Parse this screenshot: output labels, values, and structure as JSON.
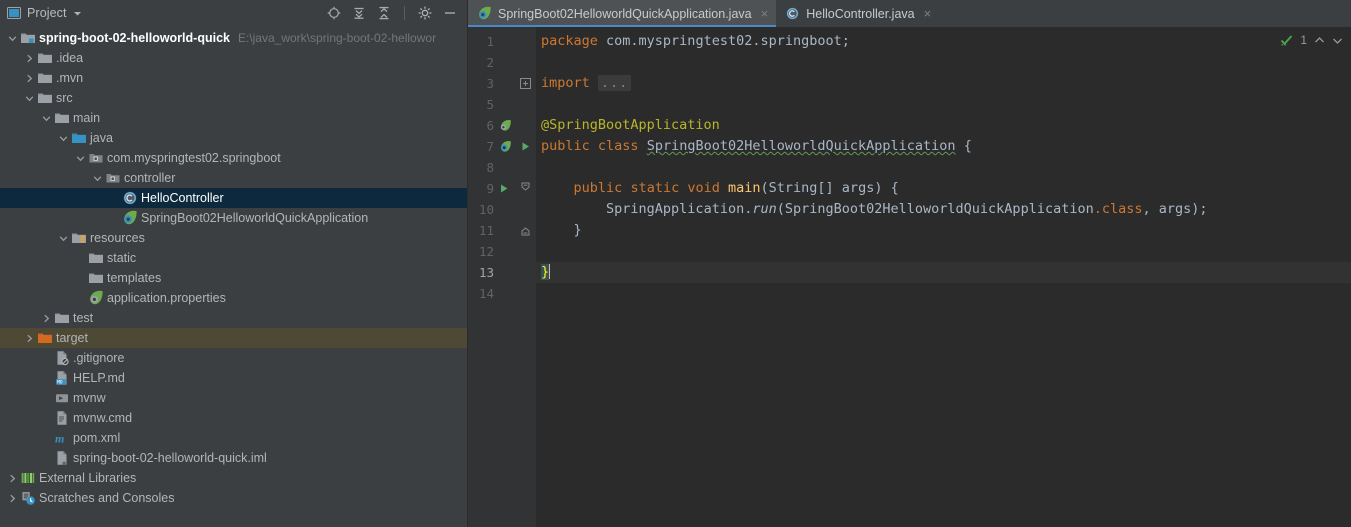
{
  "sidebar": {
    "header": {
      "title": "Project",
      "dropdown_icon": "chevron-down-icon",
      "view_icon": "project-view-icon",
      "actions": [
        {
          "name": "select-opened-file-icon",
          "label": "Select Opened File"
        },
        {
          "name": "expand-all-icon",
          "label": "Expand All"
        },
        {
          "name": "collapse-all-icon",
          "label": "Collapse All"
        },
        {
          "name": "settings-gear-icon",
          "label": "Settings"
        },
        {
          "name": "hide-panel-icon",
          "label": "Hide"
        }
      ]
    },
    "tree": [
      {
        "label": "spring-boot-02-helloworld-quick",
        "path": "E:\\java_work\\spring-boot-02-hellowor",
        "indent": 0,
        "arrow": "down",
        "icon": "module-folder-icon",
        "state": "root"
      },
      {
        "label": ".idea",
        "indent": 1,
        "arrow": "right",
        "icon": "folder-icon",
        "state": "normal"
      },
      {
        "label": ".mvn",
        "indent": 1,
        "arrow": "right",
        "icon": "folder-icon",
        "state": "normal"
      },
      {
        "label": "src",
        "indent": 1,
        "arrow": "down",
        "icon": "folder-icon",
        "state": "normal"
      },
      {
        "label": "main",
        "indent": 2,
        "arrow": "down",
        "icon": "folder-icon",
        "state": "normal"
      },
      {
        "label": "java",
        "indent": 3,
        "arrow": "down",
        "icon": "source-folder-icon",
        "state": "normal"
      },
      {
        "label": "com.myspringtest02.springboot",
        "indent": 4,
        "arrow": "down",
        "icon": "package-icon",
        "state": "normal"
      },
      {
        "label": "controller",
        "indent": 5,
        "arrow": "down",
        "icon": "package-icon",
        "state": "normal"
      },
      {
        "label": "HelloController",
        "indent": 6,
        "arrow": "none",
        "icon": "java-class-icon",
        "state": "selected"
      },
      {
        "label": "SpringBoot02HelloworldQuickApplication",
        "indent": 6,
        "arrow": "none",
        "icon": "spring-boot-class-icon",
        "state": "normal"
      },
      {
        "label": "resources",
        "indent": 3,
        "arrow": "down",
        "icon": "resources-folder-icon",
        "state": "normal"
      },
      {
        "label": "static",
        "indent": 4,
        "arrow": "none",
        "icon": "folder-icon",
        "state": "normal"
      },
      {
        "label": "templates",
        "indent": 4,
        "arrow": "none",
        "icon": "folder-icon",
        "state": "normal"
      },
      {
        "label": "application.properties",
        "indent": 4,
        "arrow": "none",
        "icon": "spring-properties-icon",
        "state": "normal"
      },
      {
        "label": "test",
        "indent": 2,
        "arrow": "right",
        "icon": "folder-icon",
        "state": "normal"
      },
      {
        "label": "target",
        "indent": 1,
        "arrow": "right",
        "icon": "excluded-folder-icon",
        "state": "target"
      },
      {
        "label": ".gitignore",
        "indent": 2,
        "arrow": "none",
        "icon": "gitignore-file-icon",
        "state": "normal"
      },
      {
        "label": "HELP.md",
        "indent": 2,
        "arrow": "none",
        "icon": "markdown-file-icon",
        "state": "normal"
      },
      {
        "label": "mvnw",
        "indent": 2,
        "arrow": "none",
        "icon": "shell-script-icon",
        "state": "normal"
      },
      {
        "label": "mvnw.cmd",
        "indent": 2,
        "arrow": "none",
        "icon": "cmd-file-icon",
        "state": "normal"
      },
      {
        "label": "pom.xml",
        "indent": 2,
        "arrow": "none",
        "icon": "maven-pom-icon",
        "state": "normal"
      },
      {
        "label": "spring-boot-02-helloworld-quick.iml",
        "indent": 2,
        "arrow": "none",
        "icon": "iml-file-icon",
        "state": "normal"
      },
      {
        "label": "External Libraries",
        "indent": 0,
        "arrow": "right",
        "icon": "libraries-icon",
        "state": "normal"
      },
      {
        "label": "Scratches and Consoles",
        "indent": 0,
        "arrow": "right",
        "icon": "scratches-icon",
        "state": "normal"
      }
    ]
  },
  "editor": {
    "tabs": [
      {
        "label": "SpringBoot02HelloworldQuickApplication.java",
        "icon": "spring-boot-class-icon",
        "active": true,
        "close_glyph": "×"
      },
      {
        "label": "HelloController.java",
        "icon": "java-class-icon",
        "active": false,
        "close_glyph": "×"
      }
    ],
    "inspection_widget": {
      "status_icon": "inspection-ok-icon",
      "count": "1",
      "prev_icon": "chevron-up-icon",
      "next_icon": "chevron-down-icon"
    },
    "line_numbers": [
      "1",
      "2",
      "3",
      "5",
      "6",
      "7",
      "8",
      "9",
      "10",
      "11",
      "12",
      "13",
      "14"
    ],
    "current_line_number": "13",
    "gutter_marks": [
      {
        "line": "6",
        "icon": "spring-bean-icon"
      },
      {
        "line": "7",
        "icon": "spring-boot-class-icon"
      },
      {
        "line": "7",
        "icon": "run-arrow-icon"
      },
      {
        "line": "9",
        "icon": "run-arrow-icon"
      }
    ],
    "fold_markers": [
      {
        "line": "3",
        "type": "expand-fold-icon"
      },
      {
        "line": "9",
        "type": "collapse-fold-icon"
      },
      {
        "line": "11",
        "type": "fold-end-icon"
      }
    ],
    "code": {
      "line1_kw": "package",
      "line1_rest": " com.myspringtest02.springboot;",
      "line3_kw": "import",
      "line3_fold": "...",
      "line6_annotation": "@SpringBootApplication",
      "line7_kw1": "public",
      "line7_kw2": "class",
      "line7_name": "SpringBoot02HelloworldQuickApplication",
      "line7_brace": "{",
      "line9_kw1": "public",
      "line9_kw2": "static",
      "line9_kw3": "void",
      "line9_method": "main",
      "line9_params": "(String[] args) {",
      "line10_cls": "SpringApplication",
      "line10_dot": ".",
      "line10_method": "run",
      "line10_arg1": "(SpringBoot02HelloworldQuickApplication",
      "line10_kw": ".class",
      "line10_arg2": ", args);",
      "line11_brace": "}",
      "line13_brace": "}"
    }
  },
  "colors": {
    "sidebar_bg": "#3c3f41",
    "editor_bg": "#2b2b2b",
    "gutter_bg": "#313335",
    "tab_active_bg": "#4e5254",
    "tab_underline": "#4a88c7",
    "selection_bg": "#0d293e",
    "target_row_bg": "#4e4935",
    "keyword": "#cc7832",
    "annotation": "#bbb529",
    "identifier": "#a9b7c6",
    "method": "#ffc66d",
    "line_number": "#606366",
    "current_line_bg": "#323232",
    "brace_match": "#ffef28"
  }
}
